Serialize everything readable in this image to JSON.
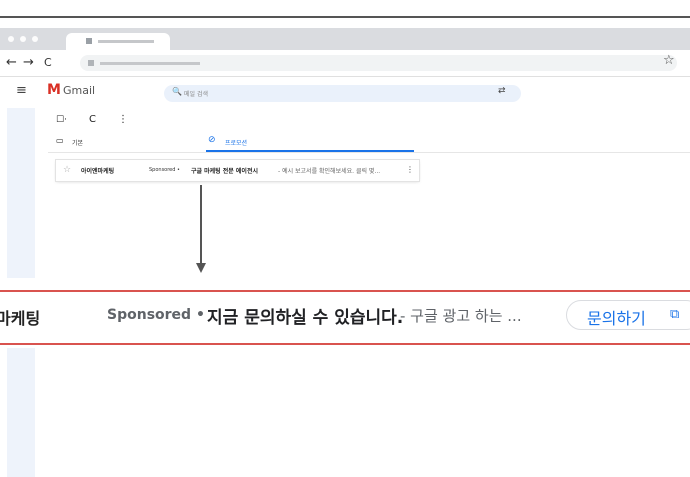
{
  "browser": {
    "back_glyph": "←",
    "forward_glyph": "→",
    "reload_glyph": "C",
    "bookmark_glyph": "☆",
    "menu_glyph": "⋮"
  },
  "gmail": {
    "brand_text": "Gmail",
    "search_placeholder": "메일 검색",
    "menu_glyph": "≡",
    "logo_glyph": "M",
    "search_glyph": "🔍",
    "tune_glyph": "⇄"
  },
  "toolbar": {
    "checkbox_glyph": "☐·",
    "refresh_glyph": "C",
    "more_glyph": "⋮"
  },
  "categories": [
    {
      "label": "기본",
      "icon": "inbox-icon",
      "glyph": "▭",
      "active": false
    },
    {
      "label": "프로모션",
      "icon": "tag-icon",
      "glyph": "⊘",
      "active": true
    }
  ],
  "row": {
    "star_glyph": "☆",
    "sender": "아이엔마케팅",
    "sponsored": "Sponsored •",
    "subject": "구글 마케팅 전문 에이전시",
    "snippet": "- 예시 보고서를 확인해보세요. 클릭 몇...",
    "more_glyph": "⋮"
  },
  "zoom": {
    "sender": "마케팅",
    "sponsored": "Sponsored",
    "bullet": "•",
    "subject": "지금 문의하실 수 있습니다.",
    "snippet": "- 구글 광고 하는 ...",
    "cta_label": "문의하기",
    "cta_glyph": "⧉"
  },
  "colors": {
    "accent": "#1a73e8",
    "highlight_border": "#d9534f",
    "gmail_red": "#d93025"
  }
}
